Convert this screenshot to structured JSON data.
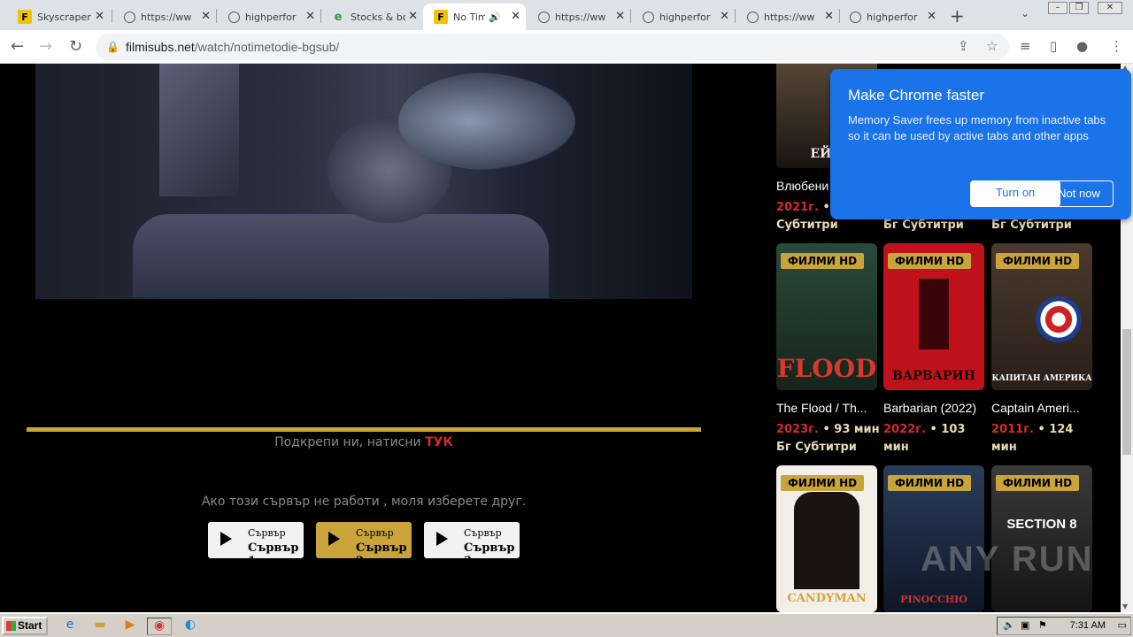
{
  "browser": {
    "tabs": [
      {
        "label": "Skyscraper",
        "icon": "yellow-f-icon"
      },
      {
        "label": "https://ww",
        "icon": "globe-icon"
      },
      {
        "label": "highperfor",
        "icon": "globe-icon"
      },
      {
        "label": "Stocks & bo",
        "icon": "green-e-icon"
      },
      {
        "label": "No Tim",
        "icon": "yellow-f-icon",
        "active": true
      },
      {
        "label": "https://ww",
        "icon": "globe-icon"
      },
      {
        "label": "highperfor",
        "icon": "globe-icon"
      },
      {
        "label": "https://ww",
        "icon": "globe-icon"
      },
      {
        "label": "highperfor",
        "icon": "globe-icon"
      }
    ],
    "url_host": "filmisubs.net",
    "url_path": "/watch/notimetodie-bgsub/"
  },
  "page": {
    "support_text": "Подкрепи ни, натисни ",
    "support_link": "ТУК",
    "server_notice": "Ако този сървър не работи , моля изберете друг.",
    "servers": [
      {
        "small": "Сървър",
        "big": "Сървър 1"
      },
      {
        "small": "Сървър",
        "big": "Сървър 2",
        "selected": true
      },
      {
        "small": "Сървър",
        "big": "Сървър 3"
      }
    ]
  },
  "sidebar": {
    "badge": "ФИЛМИ HD",
    "top_row": {
      "title1": "Влюбени",
      "meta1_year": "2021г.",
      "meta1_rest": " • мин Бг Субтитри",
      "meta2": "Бг Субтитри",
      "meta3": "Бг Субтитри"
    },
    "movies": [
      {
        "title": "The Flood / Th...",
        "year": "2023г.",
        "info": " • 93 мин Бг Субтитри",
        "poster_text": "FLOOD",
        "bg": "#1f3b2a"
      },
      {
        "title": "Barbarian (2022)",
        "year": "2022г.",
        "info": " • 103 мин",
        "poster_text": "ВАРВАРИН",
        "bg": "#c0121a"
      },
      {
        "title": "Captain Ameri...",
        "year": "2011г.",
        "info": " • 124 мин",
        "poster_text": "КАПИТАН АМЕРИКА",
        "bg": "#3a2a22"
      },
      {
        "title": "",
        "year": "",
        "info": "",
        "poster_text": "CANDYMAN",
        "bg": "#f2efe8"
      },
      {
        "title": "",
        "year": "",
        "info": "",
        "poster_text": "PINOCCHIO",
        "bg": "#1c2d4a"
      },
      {
        "title": "",
        "year": "",
        "info": "",
        "poster_text": "SECTION 8",
        "bg": "#2b2b2b"
      }
    ]
  },
  "popup": {
    "title": "Make Chrome faster",
    "body": "Memory Saver frees up memory from inactive tabs so it can be used by active tabs and other apps",
    "turn_on": "Turn on",
    "not_now": "Not now"
  },
  "taskbar": {
    "start": "Start",
    "clock": "7:31 AM"
  },
  "watermark": "ANY RUN"
}
